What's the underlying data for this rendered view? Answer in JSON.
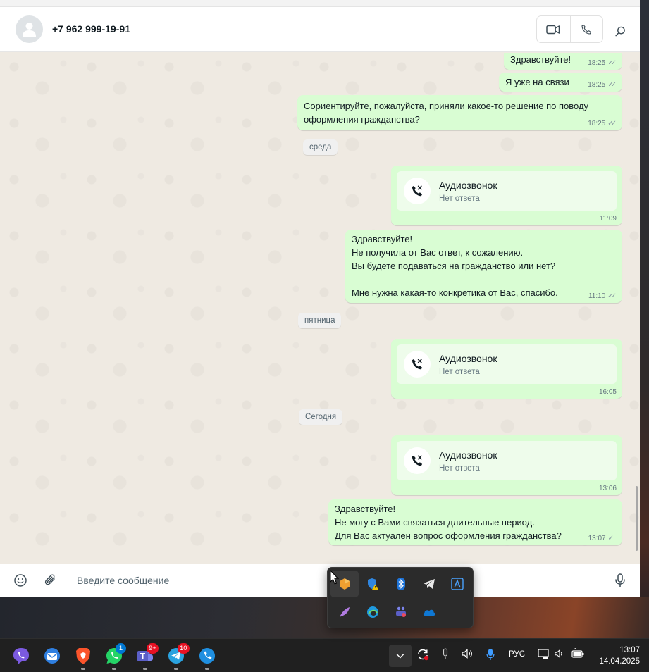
{
  "header": {
    "contact_name": "+7 962 999-19-91"
  },
  "messages": [
    {
      "text": "Здравствуйте!",
      "time": "18:25",
      "status": "read"
    },
    {
      "text": "Я уже на связи",
      "time": "18:25",
      "status": "read"
    },
    {
      "text": "Сориентируйте, пожалуйста, приняли какое-то решение по поводу\nоформления гражданства?",
      "time": "18:25",
      "status": "read"
    },
    {
      "text": "Здравствуйте!\nНе получила от Вас ответ, к сожалению.\nВы будете подаваться на гражданство или нет?\n\nМне нужна какая-то конкретика от Вас, спасибо.",
      "time": "11:10",
      "status": "read"
    },
    {
      "text": "Здравствуйте!\nНе могу с Вами связаться длительные период.\nДля Вас актуален вопрос оформления гражданства?",
      "time": "13:07",
      "status": "sent"
    }
  ],
  "dates": [
    "среда",
    "пятница",
    "Сегодня"
  ],
  "calls": [
    {
      "title": "Аудиозвонок",
      "subtitle": "Нет ответа",
      "time": "11:09"
    },
    {
      "title": "Аудиозвонок",
      "subtitle": "Нет ответа",
      "time": "16:05"
    },
    {
      "title": "Аудиозвонок",
      "subtitle": "Нет ответа",
      "time": "13:06"
    }
  ],
  "composer": {
    "placeholder": "Введите сообщение"
  },
  "taskbar": {
    "whatsapp_badge": "1",
    "teams_badge": "9+",
    "telegram_badge": "10",
    "language": "РУС",
    "time": "13:07",
    "date": "14.04.2025"
  },
  "colors": {
    "outgoing_bubble": "#d9fdd3",
    "chat_background": "#efeae2",
    "badge_blue": "#0078d4",
    "badge_red": "#e81123"
  }
}
